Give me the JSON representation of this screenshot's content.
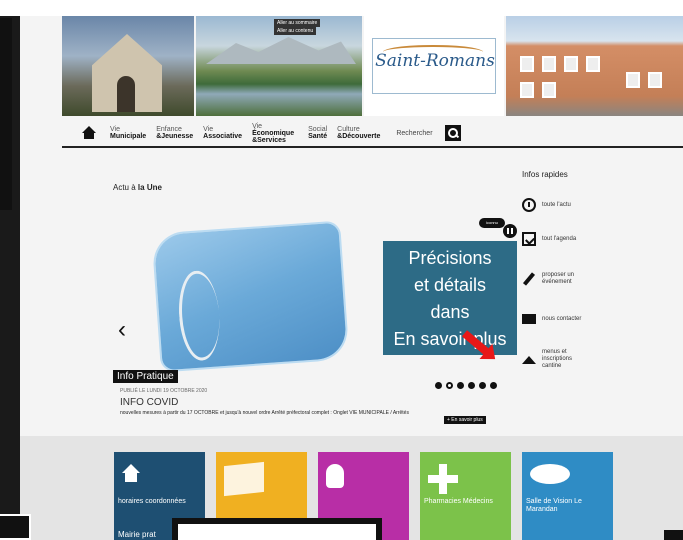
{
  "header": {
    "logo_text": "Saint-Romans",
    "small_buttons": [
      "Aller au sommaire",
      "Aller au contenu"
    ]
  },
  "nav": {
    "items": [
      {
        "l1": "Vie",
        "l2": "Municipale"
      },
      {
        "l1": "Enfance",
        "l2": "&Jeunesse"
      },
      {
        "l1": "Vie",
        "l2": "Associative"
      },
      {
        "l1": "Vie",
        "l2": "Économique &Services"
      },
      {
        "l1": "Social",
        "l2": "Santé"
      },
      {
        "l1": "Culture",
        "l2": "&Découverte"
      }
    ],
    "search_label": "Rechercher"
  },
  "main": {
    "actu_prefix": "Actu à",
    "actu_bold": "la Une",
    "tag_label": "iconnu",
    "promo_text_lines": [
      "Précisions",
      "et détails",
      "dans",
      "En savoir plus"
    ],
    "category": "Info Pratique",
    "publie": "PUBLIÉ LE LUNDI 19 OCTOBRE 2020",
    "news_title": "INFO COVID",
    "news_desc": "nouvelles mesures à partir du 17 OCTOBRE et jusqu'à nouvel ordre Arrêté préfectoral complet : Onglet VIE MUNICIPALE / Arrêtés",
    "savoir_plus": "+ En savoir plus",
    "dots_count": 6,
    "active_dot": 1
  },
  "rapides": {
    "title": "Infos rapides",
    "items": [
      {
        "label": "toute l'actu",
        "icon": "clock-icon"
      },
      {
        "label": "tout l'agenda",
        "icon": "calendar-icon"
      },
      {
        "label": "proposer un événement",
        "icon": "pen-icon"
      },
      {
        "label": "nous contacter",
        "icon": "mail-icon"
      },
      {
        "label": "menus et inscriptions cantine",
        "icon": "meal-icon"
      }
    ]
  },
  "tiles": [
    {
      "label": "horaires coordonnées",
      "color": "#1e4f72"
    },
    {
      "label": "",
      "color": "#f0b021"
    },
    {
      "label": "",
      "color": "#b82ea6"
    },
    {
      "label": "Pharmacies Médecins",
      "color": "#7cc24a"
    },
    {
      "label": "Salle de Vision Le Marandan",
      "color": "#2f8cc5"
    }
  ],
  "mairie_label": "Mairie prat"
}
